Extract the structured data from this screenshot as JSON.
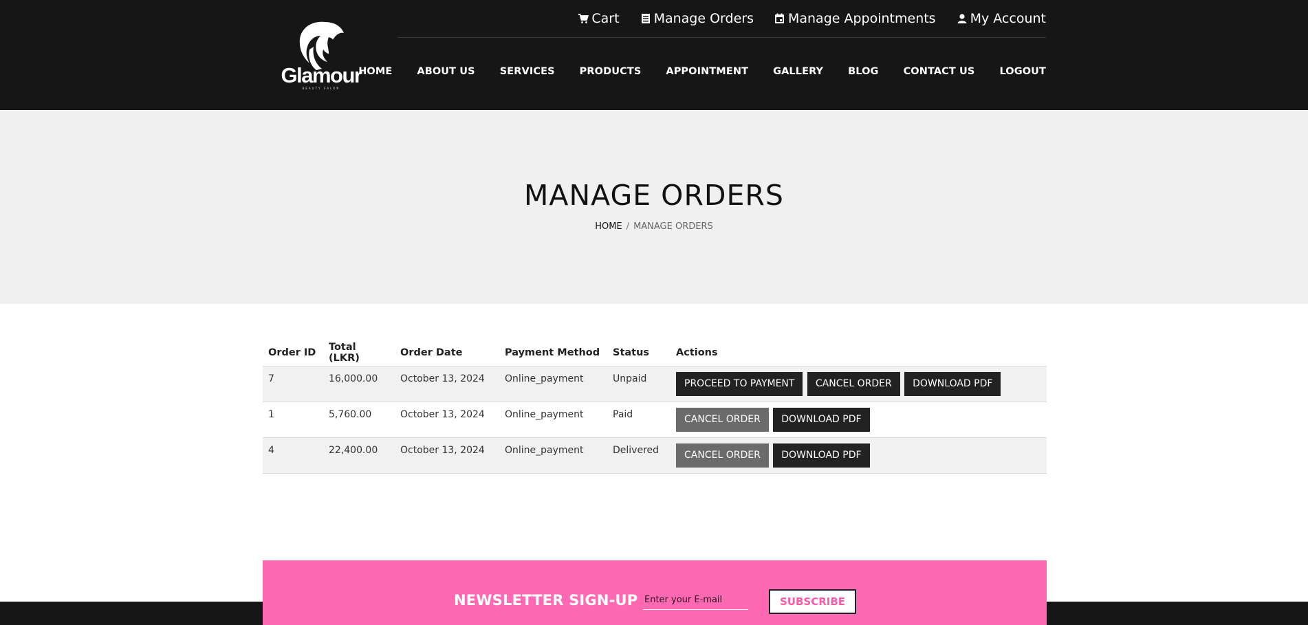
{
  "header": {
    "logo_text": "Glamour",
    "logo_subtext": "BEAUTY SALON",
    "top_links": [
      {
        "label": "Cart",
        "icon": "cart-icon"
      },
      {
        "label": "Manage Orders",
        "icon": "document-icon"
      },
      {
        "label": "Manage Appointments",
        "icon": "calendar-icon"
      },
      {
        "label": "My Account",
        "icon": "user-icon"
      }
    ],
    "nav": [
      "HOME",
      "ABOUT US",
      "SERVICES",
      "PRODUCTS",
      "APPOINTMENT",
      "GALLERY",
      "BLOG",
      "CONTACT US",
      "LOGOUT"
    ]
  },
  "banner": {
    "title": "MANAGE ORDERS",
    "breadcrumb_home": "HOME",
    "breadcrumb_sep": "/",
    "breadcrumb_current": "MANAGE ORDERS"
  },
  "orders_table": {
    "headers": [
      "Order ID",
      "Total (LKR)",
      "Order Date",
      "Payment Method",
      "Status",
      "Actions"
    ],
    "rows": [
      {
        "id": "7",
        "total": "16,000.00",
        "date": "October 13, 2024",
        "method": "Online_payment",
        "status": "Unpaid",
        "actions": {
          "proceed": "PROCEED TO PAYMENT",
          "cancel": "CANCEL ORDER",
          "download": "DOWNLOAD PDF"
        }
      },
      {
        "id": "1",
        "total": "5,760.00",
        "date": "October 13, 2024",
        "method": "Online_payment",
        "status": "Paid",
        "actions": {
          "cancel": "CANCEL ORDER",
          "download": "DOWNLOAD PDF"
        }
      },
      {
        "id": "4",
        "total": "22,400.00",
        "date": "October 13, 2024",
        "method": "Online_payment",
        "status": "Delivered",
        "actions": {
          "cancel": "CANCEL ORDER",
          "download": "DOWNLOAD PDF"
        }
      }
    ]
  },
  "newsletter": {
    "title": "NEWSLETTER SIGN-UP",
    "input_placeholder": "Enter your E-mail",
    "button": "SUBSCRIBE"
  },
  "colors": {
    "header_bg": "#161616",
    "banner_bg": "#f0f0f0",
    "newsletter_bg": "#ff69b4",
    "button_dark": "#222222",
    "button_grey": "#6b6b6b"
  }
}
